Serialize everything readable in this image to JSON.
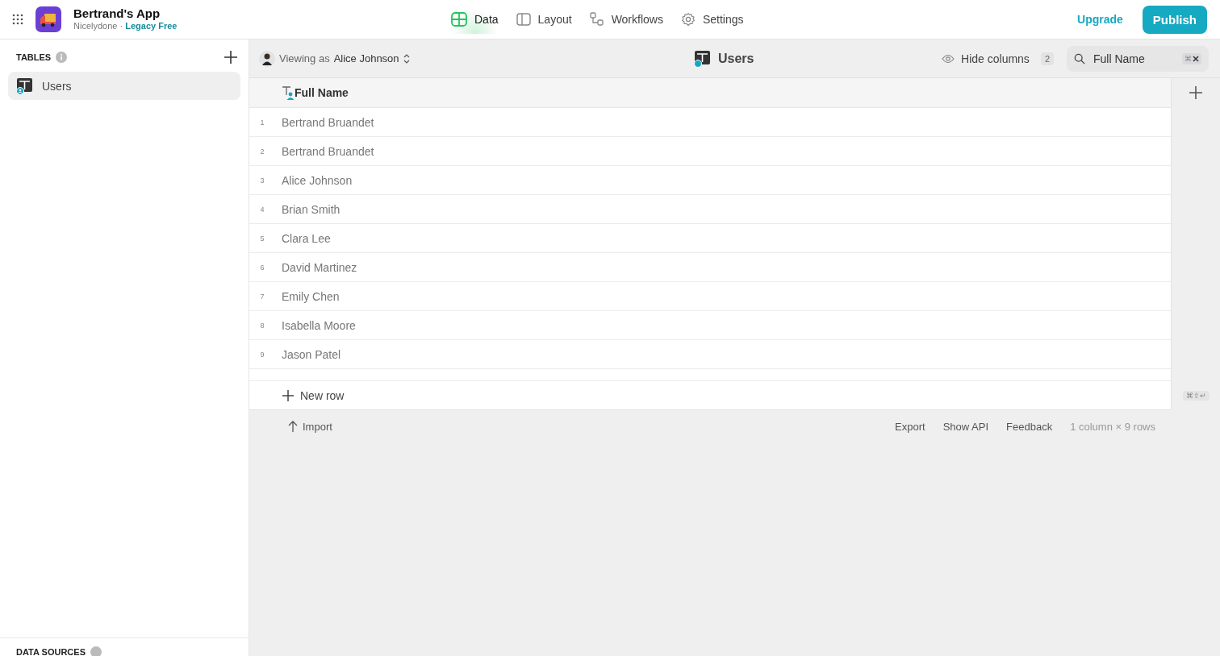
{
  "app": {
    "name": "Bertrand's App",
    "workspace": "Nicelydone",
    "separator": "·",
    "plan": "Legacy Free"
  },
  "nav": [
    {
      "label": "Data",
      "selected": true
    },
    {
      "label": "Layout",
      "selected": false
    },
    {
      "label": "Workflows",
      "selected": false
    },
    {
      "label": "Settings",
      "selected": false
    }
  ],
  "header_actions": {
    "upgrade": "Upgrade",
    "publish": "Publish"
  },
  "sidebar": {
    "section": "TABLES",
    "items": [
      {
        "label": "Users",
        "selected": true
      }
    ],
    "footer_section": "DATA SOURCES"
  },
  "toolbar": {
    "viewing_prefix": "Viewing as",
    "viewing_user": "Alice Johnson",
    "table_title": "Users",
    "hide_columns": "Hide columns",
    "hidden_count": "2",
    "search_value": "Full Name",
    "search_shortcut": "⌘"
  },
  "table": {
    "columns": [
      "Full Name"
    ],
    "rows": [
      {
        "index": "1",
        "full_name": "Bertrand Bruandet"
      },
      {
        "index": "2",
        "full_name": "Bertrand Bruandet"
      },
      {
        "index": "3",
        "full_name": "Alice Johnson"
      },
      {
        "index": "4",
        "full_name": "Brian Smith"
      },
      {
        "index": "5",
        "full_name": "Clara Lee"
      },
      {
        "index": "6",
        "full_name": "David Martinez"
      },
      {
        "index": "7",
        "full_name": "Emily Chen"
      },
      {
        "index": "8",
        "full_name": "Isabella Moore"
      },
      {
        "index": "9",
        "full_name": "Jason Patel"
      }
    ],
    "new_row": "New row",
    "new_row_shortcut": "⌘⇧↵"
  },
  "footer": {
    "import": "Import",
    "links": [
      "Export",
      "Show API",
      "Feedback"
    ],
    "summary": "1 column × 9 rows"
  }
}
